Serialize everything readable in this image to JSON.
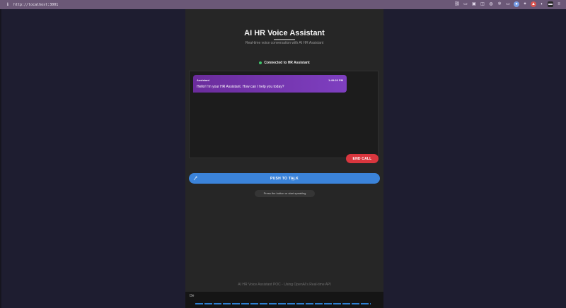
{
  "browser": {
    "url": "http://localhost:3001"
  },
  "app": {
    "title": "AI HR Voice Assistant",
    "subtitle": "Real-time voice conversation with AI HR Assistant",
    "status_text": "Connected to HR Assistant",
    "messages": [
      {
        "sender": "Assistant",
        "time": "1:49:20 PM",
        "text": "Hello! I'm your HR Assistant. How can I help you today?"
      }
    ],
    "end_call_label": "END CALL",
    "push_to_talk_label": "PUSH TO TALK",
    "hint": "Press the button or start speaking",
    "footer": "AI HR Voice Assistant POC - Using OpenAI's Real-time API",
    "debug_label": "De"
  },
  "colors": {
    "accent_blue": "#3b83d9",
    "end_call_red": "#d9363e",
    "message_purple": "#7e3fc0",
    "status_green": "#3fc46b"
  }
}
